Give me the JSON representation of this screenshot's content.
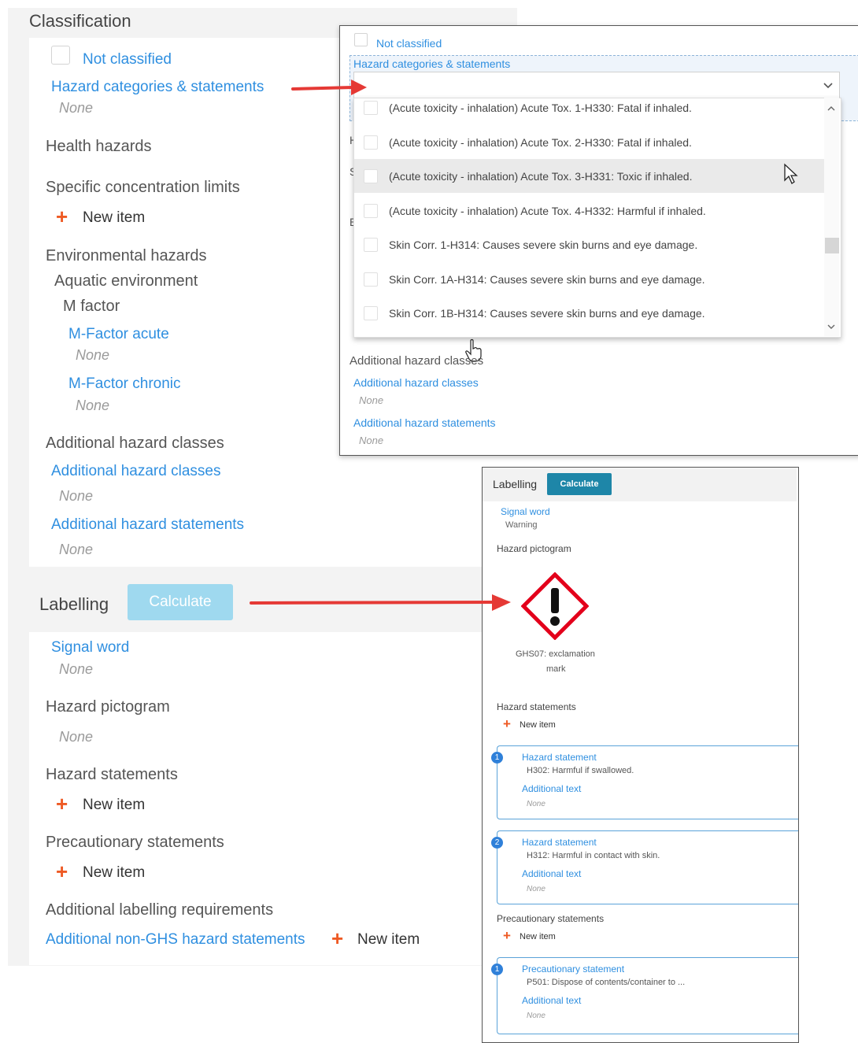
{
  "classification": {
    "title": "Classification",
    "not_classified": "Not classified",
    "hazard_categories": "Hazard categories & statements",
    "hazard_categories_value": "None",
    "health_hazards": "Health hazards",
    "specific_concentration_limits": "Specific concentration limits",
    "new_item": "New item",
    "environmental_hazards": "Environmental hazards",
    "aquatic_environment": "Aquatic environment",
    "m_factor": "M factor",
    "m_factor_acute": "M-Factor acute",
    "m_factor_acute_value": "None",
    "m_factor_chronic": "M-Factor chronic",
    "m_factor_chronic_value": "None",
    "additional_hazard_classes_heading": "Additional hazard classes",
    "additional_hazard_classes": "Additional hazard classes",
    "additional_hazard_classes_value": "None",
    "additional_hazard_statements": "Additional hazard statements",
    "additional_hazard_statements_value": "None"
  },
  "labelling": {
    "title": "Labelling",
    "calculate": "Calculate",
    "signal_word": "Signal word",
    "signal_word_value": "None",
    "hazard_pictogram": "Hazard pictogram",
    "hazard_pictogram_value": "None",
    "hazard_statements": "Hazard statements",
    "hazard_statements_new": "New item",
    "precautionary_statements": "Precautionary statements",
    "precautionary_statements_new": "New item",
    "additional_labelling": "Additional labelling requirements",
    "additional_non_ghs": "Additional non-GHS hazard statements",
    "additional_non_ghs_new": "New item"
  },
  "dropdown": {
    "not_classified": "Not classified",
    "field_label": "Hazard categories & statements",
    "options": [
      "(Acute toxicity - inhalation) Acute Tox. 1-H330: Fatal if inhaled.",
      "(Acute toxicity - inhalation) Acute Tox. 2-H330: Fatal if inhaled.",
      "(Acute toxicity - inhalation) Acute Tox. 3-H331: Toxic if inhaled.",
      "(Acute toxicity - inhalation) Acute Tox. 4-H332: Harmful if inhaled.",
      "Skin Corr. 1-H314: Causes severe skin burns and eye damage.",
      "Skin Corr. 1A-H314: Causes severe skin burns and eye damage.",
      "Skin Corr. 1B-H314: Causes severe skin burns and eye damage."
    ],
    "hovered_index": 2,
    "additional_hazard_classes_heading": "Additional hazard classes",
    "additional_hazard_classes": "Additional hazard classes",
    "additional_hazard_classes_value": "None",
    "additional_hazard_statements": "Additional hazard statements",
    "additional_hazard_statements_value": "None"
  },
  "labelling_result": {
    "title": "Labelling",
    "calculate": "Calculate",
    "signal_word": "Signal word",
    "signal_word_value": "Warning",
    "hazard_pictogram": "Hazard pictogram",
    "pictogram_caption_1": "GHS07: exclamation",
    "pictogram_caption_2": "mark",
    "hazard_statements": "Hazard statements",
    "new_item": "New item",
    "statements": [
      {
        "index": "1",
        "label": "Hazard statement",
        "value": "H302: Harmful if swallowed.",
        "additional_label": "Additional text",
        "additional_value": "None"
      },
      {
        "index": "2",
        "label": "Hazard statement",
        "value": "H312: Harmful in contact with skin.",
        "additional_label": "Additional text",
        "additional_value": "None"
      }
    ],
    "precautionary_statements": "Precautionary statements",
    "precautionary_new_item": "New item",
    "precautionary": [
      {
        "index": "1",
        "label": "Precautionary statement",
        "value": "P501: Dispose of contents/container to ...",
        "additional_label": "Additional text",
        "additional_value": "None"
      }
    ]
  },
  "colors": {
    "link_blue": "#2f8fe0",
    "arrow_red": "#e53935",
    "calculate_light": "#9fd9ef",
    "calculate_dark": "#1e86a8",
    "new_item_plus": "#ee5a24"
  }
}
